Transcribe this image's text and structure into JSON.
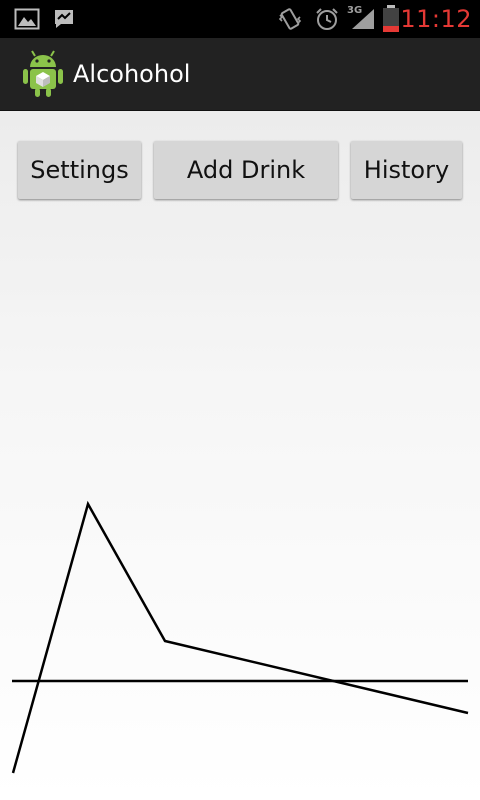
{
  "status_bar": {
    "time": "11:12",
    "network_label": "3G",
    "icons": [
      "gallery-icon",
      "messenger-icon",
      "vibrate-icon",
      "alarm-icon",
      "signal-icon",
      "battery-icon"
    ],
    "time_color": "#e53935",
    "battery_level": 0.15
  },
  "action_bar": {
    "title": "Alcohohol",
    "icon": "android-app-icon"
  },
  "buttons": {
    "settings": "Settings",
    "add_drink": "Add Drink",
    "history": "History"
  }
}
